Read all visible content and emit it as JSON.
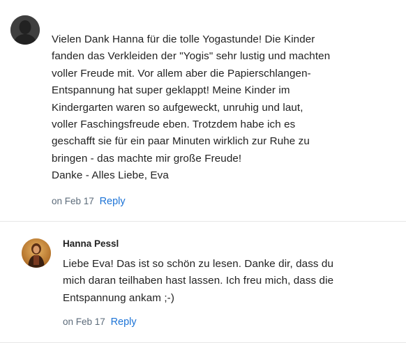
{
  "comments": [
    {
      "text": "Vielen Dank Hanna für die tolle Yogastunde! Die Kinder\nfanden das Verkleiden der \"Yogis\" sehr lustig und machten\nvoller Freude mit. Vor allem aber die Papierschlangen-\nEntspannung hat super geklappt! Meine Kinder im\nKindergarten waren so aufgeweckt, unruhig und laut,\nvoller Faschingsfreude eben. Trotzdem habe ich es\ngeschafft sie für ein paar Minuten wirklich zur Ruhe zu\nbringen - das machte mir große Freude!\nDanke - Alles Liebe, Eva",
      "date": "on Feb 17",
      "reply_label": "Reply",
      "avatar_icon": "user-silhouette-icon"
    },
    {
      "author": "Hanna Pessl",
      "text": "Liebe Eva! Das ist so schön zu lesen. Danke dir, dass du\nmich daran teilhaben hast lassen. Ich freu mich, dass die\nEntspannung ankam ;-)",
      "date": "on Feb 17",
      "reply_label": "Reply",
      "avatar_icon": "profile-photo"
    }
  ],
  "colors": {
    "link": "#1c73d6",
    "meta": "#5c6b7a",
    "divider": "#e6e6e6"
  }
}
